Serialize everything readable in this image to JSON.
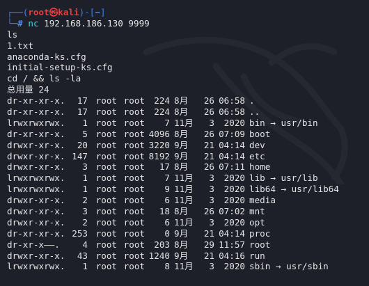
{
  "prompt": {
    "frame_top": "┌──(",
    "user": "root",
    "at": "㉿",
    "host": "kali",
    "mid": ")-[",
    "path": "~",
    "end": "]",
    "frame_bottom": "└─",
    "symbol": "#",
    "cmd": "nc",
    "args": " 192.168.186.130 9999"
  },
  "lines": [
    "ls",
    "1.txt",
    "anaconda-ks.cfg",
    "initial-setup-ks.cfg",
    "cd / && ls -la",
    "总用量 24"
  ],
  "listing": [
    {
      "perm": "dr-xr-xr-x.",
      "links": "17",
      "owner": "root",
      "group": "root",
      "size": "224",
      "month": "8月",
      "day": "26",
      "time": "06:58",
      "name": "."
    },
    {
      "perm": "dr-xr-xr-x.",
      "links": "17",
      "owner": "root",
      "group": "root",
      "size": "224",
      "month": "8月",
      "day": "26",
      "time": "06:58",
      "name": ".."
    },
    {
      "perm": "lrwxrwxrwx.",
      "links": "1",
      "owner": "root",
      "group": "root",
      "size": "7",
      "month": "11月",
      "day": "3",
      "time": "2020",
      "name": "bin → usr/bin"
    },
    {
      "perm": "dr-xr-xr-x.",
      "links": "5",
      "owner": "root",
      "group": "root",
      "size": "4096",
      "month": "8月",
      "day": "26",
      "time": "07:09",
      "name": "boot"
    },
    {
      "perm": "drwxr-xr-x.",
      "links": "20",
      "owner": "root",
      "group": "root",
      "size": "3220",
      "month": "9月",
      "day": "21",
      "time": "04:14",
      "name": "dev"
    },
    {
      "perm": "drwxr-xr-x.",
      "links": "147",
      "owner": "root",
      "group": "root",
      "size": "8192",
      "month": "9月",
      "day": "21",
      "time": "04:14",
      "name": "etc"
    },
    {
      "perm": "drwxr-xr-x.",
      "links": "3",
      "owner": "root",
      "group": "root",
      "size": "17",
      "month": "8月",
      "day": "26",
      "time": "07:11",
      "name": "home"
    },
    {
      "perm": "lrwxrwxrwx.",
      "links": "1",
      "owner": "root",
      "group": "root",
      "size": "7",
      "month": "11月",
      "day": "3",
      "time": "2020",
      "name": "lib → usr/lib"
    },
    {
      "perm": "lrwxrwxrwx.",
      "links": "1",
      "owner": "root",
      "group": "root",
      "size": "9",
      "month": "11月",
      "day": "3",
      "time": "2020",
      "name": "lib64 → usr/lib64"
    },
    {
      "perm": "drwxr-xr-x.",
      "links": "2",
      "owner": "root",
      "group": "root",
      "size": "6",
      "month": "11月",
      "day": "3",
      "time": "2020",
      "name": "media"
    },
    {
      "perm": "drwxr-xr-x.",
      "links": "3",
      "owner": "root",
      "group": "root",
      "size": "18",
      "month": "8月",
      "day": "26",
      "time": "07:02",
      "name": "mnt"
    },
    {
      "perm": "drwxr-xr-x.",
      "links": "2",
      "owner": "root",
      "group": "root",
      "size": "6",
      "month": "11月",
      "day": "3",
      "time": "2020",
      "name": "opt"
    },
    {
      "perm": "dr-xr-xr-x.",
      "links": "253",
      "owner": "root",
      "group": "root",
      "size": "0",
      "month": "9月",
      "day": "21",
      "time": "04:14",
      "name": "proc"
    },
    {
      "perm": "dr-xr-x——.",
      "links": "4",
      "owner": "root",
      "group": "root",
      "size": "203",
      "month": "8月",
      "day": "29",
      "time": "11:57",
      "name": "root"
    },
    {
      "perm": "drwxr-xr-x.",
      "links": "43",
      "owner": "root",
      "group": "root",
      "size": "1240",
      "month": "9月",
      "day": "21",
      "time": "04:16",
      "name": "run"
    },
    {
      "perm": "lrwxrwxrwx.",
      "links": "1",
      "owner": "root",
      "group": "root",
      "size": "8",
      "month": "11月",
      "day": "3",
      "time": "2020",
      "name": "sbin → usr/sbin"
    }
  ],
  "theme": {
    "background": "#1d2028",
    "prompt_frame": "#3f7ee8",
    "prompt_user": "#ee3a3a",
    "command": "#3fd0e0"
  }
}
